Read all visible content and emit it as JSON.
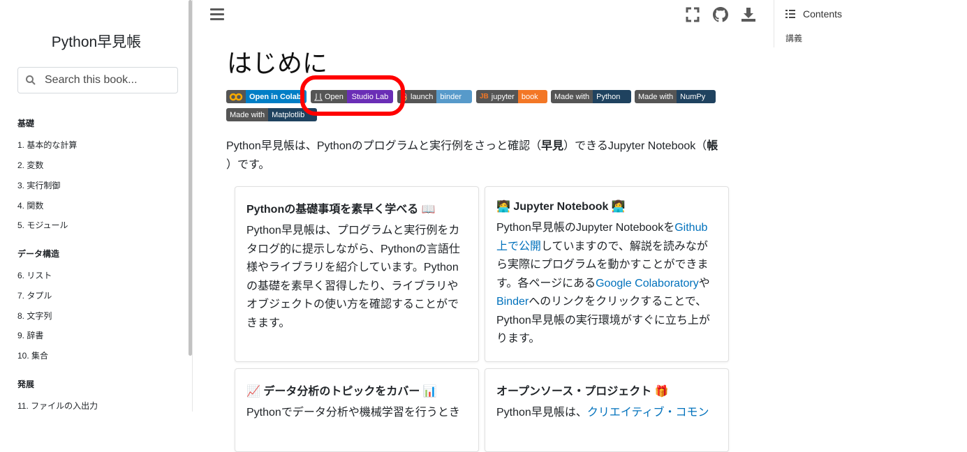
{
  "sidebar": {
    "title": "Python早見帳",
    "search_placeholder": "Search this book...",
    "sections": [
      {
        "label": "基礎",
        "items": [
          "1. 基本的な計算",
          "2. 変数",
          "3. 実行制御",
          "4. 関数",
          "5. モジュール"
        ]
      },
      {
        "label": "データ構造",
        "items": [
          "6. リスト",
          "7. タプル",
          "8. 文字列",
          "9. 辞書",
          "10. 集合"
        ]
      },
      {
        "label": "発展",
        "items": [
          "11. ファイルの入出力"
        ]
      }
    ]
  },
  "toc": {
    "heading": "Contents",
    "items": [
      "講義"
    ]
  },
  "main": {
    "title": "はじめに",
    "badges": [
      {
        "left": "Open in Colab",
        "color": "#007ec6"
      },
      {
        "left": "Open",
        "right": "Studio Lab",
        "color": "#6a2eb6"
      },
      {
        "left": "launch",
        "right": "binder",
        "color": "#579aca"
      },
      {
        "left": "jupyter",
        "right": "book",
        "color": "#f37726"
      },
      {
        "left": "Made with",
        "right": "Python",
        "color": "#1f425f"
      },
      {
        "left": "Made with",
        "right": "NumPy",
        "color": "#1f425f"
      },
      {
        "left": "Made with",
        "right": "Matplotlib",
        "color": "#1f425f"
      }
    ],
    "intro": {
      "p1": "Python早見帳は、Pythonのプログラムと実行例をさっと確認（",
      "b1": "早見",
      "p2": "）できるJupyter Notebook（",
      "b2": "帳",
      "p3": "）です。"
    },
    "cards": [
      {
        "title": "Pythonの基礎事項を素早く学べる 📖",
        "body": "Python早見帳は、プログラムと実行例をカタログ的に提示しながら、Pythonの言語仕様やライブラリを紹介しています。Pythonの基礎を素早く習得したり、ライブラリやオブジェクトの使い方を確認することができます。"
      },
      {
        "title": "🧑‍💻 Jupyter Notebook 👩‍💻",
        "t1": "Python早見帳のJupyter Notebookを",
        "link1": "Github上で公開",
        "t2": "していますので、解説を読みながら実際にプログラムを動かすことができます。各ページにある",
        "link2": "Google Colaboratory",
        "t3": "や",
        "link3": "Binder",
        "t4": "へのリンクをクリックすることで、Python早見帳の実行環境がすぐに立ち上がります。"
      },
      {
        "title": "📈 データ分析のトピックをカバー 📊",
        "body": "Pythonでデータ分析や機械学習を行うとき"
      },
      {
        "title": "オープンソース・プロジェクト 🎁",
        "t1": "Python早見帳は、",
        "link1": "クリエイティブ・コモン"
      }
    ]
  }
}
